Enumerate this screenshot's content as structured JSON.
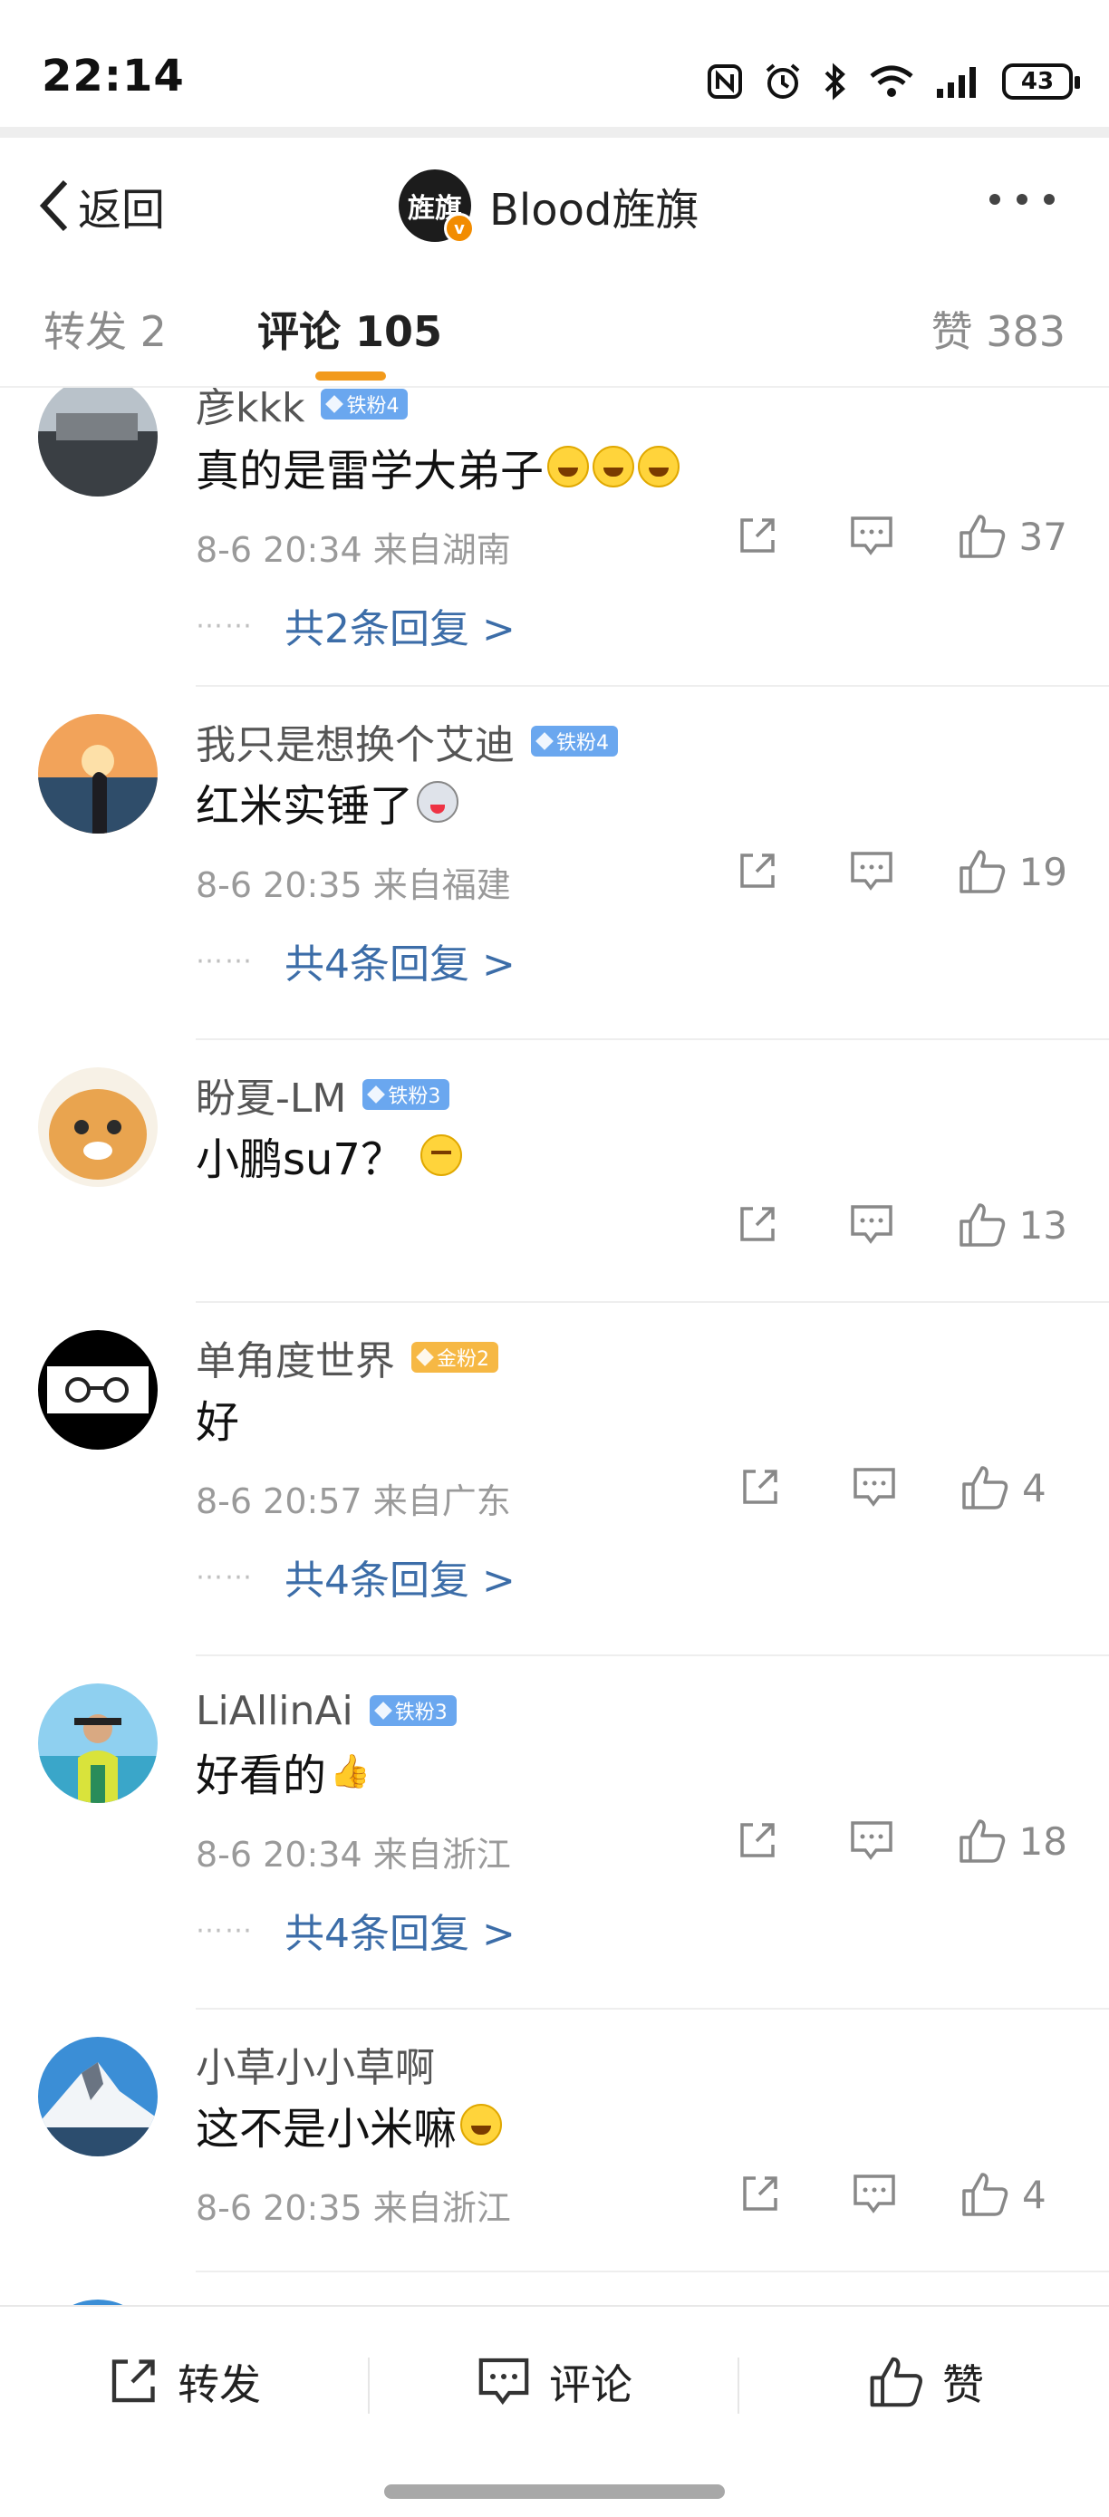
{
  "status": {
    "time": "22:14",
    "battery": "43"
  },
  "header": {
    "back_label": "返回",
    "title": "Blood旌旗",
    "avatar_text": "旌旗"
  },
  "tabs": [
    {
      "label": "转发 2"
    },
    {
      "label": "评论 105"
    },
    {
      "label": "赞 383"
    }
  ],
  "comments": [
    {
      "name": "彦kkk",
      "badge": "铁粉4",
      "badge_type": "iron",
      "text": "真的是雷学大弟子",
      "emoji": [
        "laugh",
        "laugh",
        "laugh"
      ],
      "meta": "8-6 20:34 来自湖南",
      "likes": "37",
      "replies": "共2条回复 >"
    },
    {
      "name": "我只是想换个艾迪",
      "badge": "铁粉4",
      "badge_type": "iron",
      "text": "红米实锤了",
      "emoji": [
        "dog"
      ],
      "meta": "8-6 20:35 来自福建",
      "likes": "19",
      "replies": "共4条回复 >"
    },
    {
      "name": "盼夏-LM",
      "badge": "铁粉3",
      "badge_type": "iron",
      "text": "小鹏su7？",
      "emoji": [
        "smirk"
      ],
      "meta": "",
      "likes": "13",
      "replies": ""
    },
    {
      "name": "单角度世界",
      "badge": "金粉2",
      "badge_type": "gold",
      "text": "好",
      "emoji": [],
      "meta": "8-6 20:57 来自广东",
      "likes": "4",
      "replies": "共4条回复 >"
    },
    {
      "name": "LiAllinAi",
      "badge": "铁粉3",
      "badge_type": "iron",
      "text": "好看的",
      "emoji": [
        "thumb"
      ],
      "meta": "8-6 20:34 来自浙江",
      "likes": "18",
      "replies": "共4条回复 >"
    },
    {
      "name": "小草小小草啊",
      "badge": "",
      "badge_type": "",
      "text": "这不是小米嘛",
      "emoji": [
        "laugh"
      ],
      "meta": "8-6 20:35 来自浙江",
      "likes": "4",
      "replies": ""
    }
  ],
  "bottom": {
    "repost": "转发",
    "comment": "评论",
    "like": "赞"
  }
}
